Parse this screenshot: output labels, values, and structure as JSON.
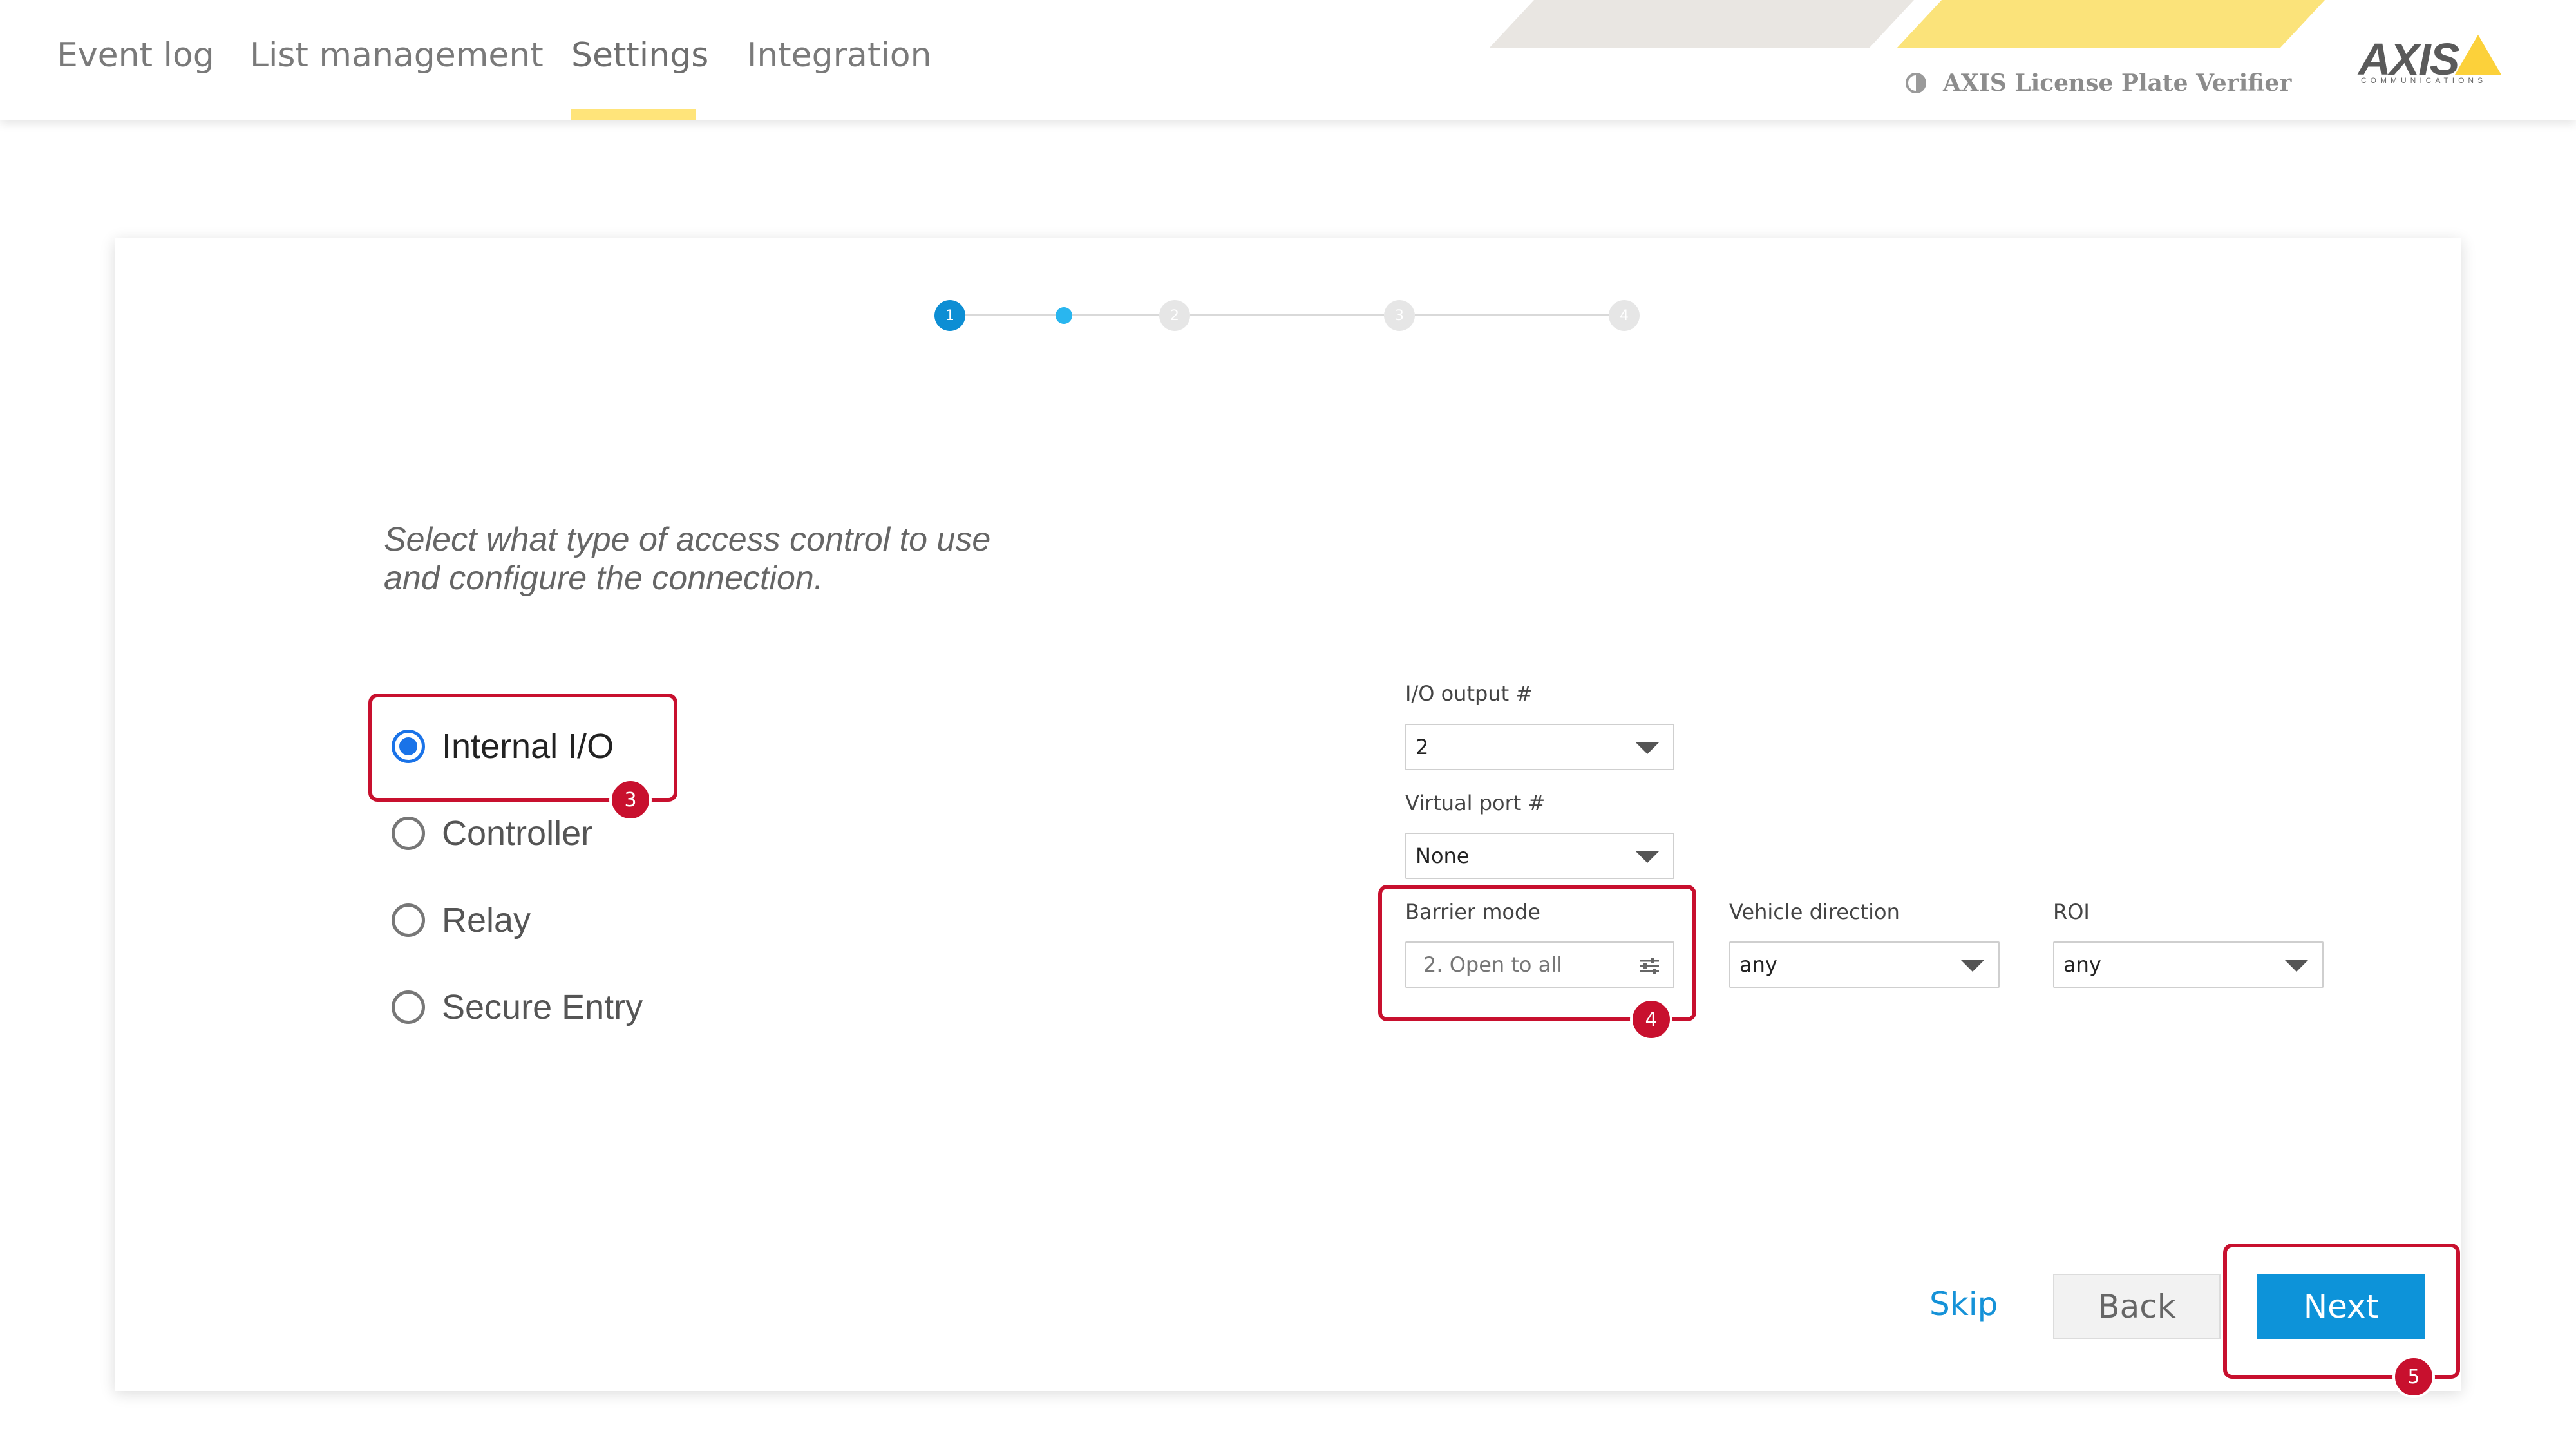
{
  "nav": {
    "tabs": [
      "Event log",
      "List management",
      "Settings",
      "Integration"
    ],
    "active_tab": "Settings"
  },
  "header": {
    "product_name": "AXIS License Plate Verifier",
    "logo_text": "AXIS",
    "logo_subtext": "COMMUNICATIONS"
  },
  "stepper": {
    "steps": [
      "1",
      "2",
      "3",
      "4"
    ],
    "current_step": 1
  },
  "instruction": {
    "line1": "Select what type of access control to use",
    "line2": "and configure the connection."
  },
  "access_types": {
    "options": [
      "Internal I/O",
      "Controller",
      "Relay",
      "Secure Entry"
    ],
    "selected": "Internal I/O"
  },
  "form": {
    "io_output": {
      "label": "I/O output #",
      "value": "2"
    },
    "virtual_port": {
      "label": "Virtual port #",
      "value": "None"
    },
    "barrier_mode": {
      "label": "Barrier mode",
      "value": "2. Open to all"
    },
    "vehicle_direction": {
      "label": "Vehicle direction",
      "value": "any"
    },
    "roi": {
      "label": "ROI",
      "value": "any"
    }
  },
  "buttons": {
    "skip": "Skip",
    "back": "Back",
    "next": "Next"
  },
  "annotations": {
    "badges": [
      "3",
      "4",
      "5"
    ],
    "color": "#c8102e"
  },
  "colors": {
    "accent_blue": "#0d93d9",
    "tab_underline": "#ffe47a",
    "radio_selected": "#1a73e8"
  }
}
